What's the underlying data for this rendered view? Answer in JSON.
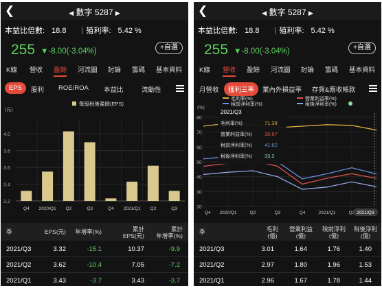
{
  "left": {
    "title": "數字 5287",
    "pe_label": "本益比倍數:",
    "pe_value": "18.8",
    "yield_label": "殖利率:",
    "yield_value": "5.42 %",
    "price": "255",
    "change": "▼-8.00(-3.04%)",
    "watch_label": "+自選",
    "tabs": [
      "K線",
      "營收",
      "盈餘",
      "河流圖",
      "討論",
      "籌碼",
      "基本資料"
    ],
    "active_tab": 2,
    "subtabs": [
      "EPS",
      "股利",
      "ROE/ROA",
      "本益比",
      "流動性"
    ],
    "active_subtab": 0,
    "chart_data": {
      "type": "bar",
      "legend": "每股稅後盈餘(EPS)",
      "unit_label": "(元)",
      "categories": [
        "Q4",
        "2020/Q1",
        "Q2",
        "Q3",
        "Q4",
        "2021/Q1",
        "Q2",
        "Q3"
      ],
      "values": [
        3.32,
        3.55,
        4.03,
        3.9,
        3.23,
        3.43,
        3.62,
        3.32
      ],
      "ylim": [
        3.2,
        4.1
      ],
      "yticks": [
        "4.0",
        "3.8",
        "3.6",
        "3.4",
        "3.2"
      ],
      "bar_color": "#d9c98f"
    },
    "table": {
      "headers": [
        "季",
        "EPS(元)",
        "年增率(%)",
        "累計EPS(元)",
        "累計年增率(%)"
      ],
      "headers_display": [
        [
          "季"
        ],
        [
          "EPS(元)"
        ],
        [
          "年增率(%)"
        ],
        [
          "累計",
          "EPS(元)"
        ],
        [
          "累計",
          "年增率(%)"
        ]
      ],
      "rows": [
        [
          "2021/Q3",
          "3.32",
          "-15.1",
          "10.37",
          "-9.9"
        ],
        [
          "2021/Q2",
          "3.62",
          "-10.4",
          "7.05",
          "-7.2"
        ],
        [
          "2021/Q1",
          "3.43",
          "-3.7",
          "3.43",
          "-3.7"
        ]
      ]
    }
  },
  "right": {
    "title": "數字 5287",
    "pe_label": "本益比倍數:",
    "pe_value": "18.8",
    "yield_label": "殖利率:",
    "yield_value": "5.42 %",
    "price": "255",
    "change": "▼-8.00(-3.04%)",
    "watch_label": "+自選",
    "tabs": [
      "K線",
      "營收",
      "盈餘",
      "河流圖",
      "討論",
      "籌碼",
      "基本資料"
    ],
    "active_tab": 1,
    "subtabs": [
      "月營收",
      "獲利三率",
      "業內外損益率",
      "存貨&應收帳款"
    ],
    "active_subtab": 1,
    "chart_data": {
      "type": "line",
      "unit_label": "(%)",
      "legend": [
        {
          "name": "毛利率(%)",
          "color": "#e0b040"
        },
        {
          "name": "營業利益率(%)",
          "color": "#e05050"
        },
        {
          "name": "稅前淨利率(%)",
          "color": "#6a8fe0"
        },
        {
          "name": "稅後淨利率(%)",
          "color": "#8fa8e0"
        }
      ],
      "categories": [
        "Q4",
        "2020/Q1",
        "Q2",
        "Q3",
        "Q4",
        "2021/Q1",
        "Q2",
        "Q3"
      ],
      "yticks": [
        "80",
        "70",
        "60",
        "50",
        "40",
        "30",
        "20"
      ],
      "ylim": [
        20,
        80
      ],
      "series": [
        {
          "name": "毛利率(%)",
          "color": "#e0b040",
          "values": [
            74,
            76,
            75,
            73,
            74,
            75,
            74.5,
            71.38
          ]
        },
        {
          "name": "營業利益率(%)",
          "color": "#e05050",
          "values": [
            47,
            49,
            51,
            47,
            35,
            39,
            42,
            38.87
          ]
        },
        {
          "name": "稅前淨利率(%)",
          "color": "#6a8fe0",
          "values": [
            52,
            53.5,
            54.5,
            50,
            38.5,
            42,
            46,
            41.82
          ]
        },
        {
          "name": "稅後淨利率(%)",
          "color": "#8fa8e0",
          "values": [
            41.5,
            43,
            44,
            40,
            31.5,
            33,
            36.5,
            33.2
          ]
        }
      ],
      "tooltip": {
        "title": "2021/Q3",
        "rows": [
          {
            "label": "毛利率(%)",
            "value": "71.38",
            "color": "#e0b040"
          },
          {
            "label": "營業利益率(%)",
            "value": "38.87",
            "color": "#e05050"
          },
          {
            "label": "稅前淨利率(%)",
            "value": "41.82",
            "color": "#6a8fe0"
          },
          {
            "label": "稅後淨利率(%)",
            "value": "33.2",
            "color": "#8fe0a0"
          }
        ]
      },
      "cursor_label": "2021/Q3"
    },
    "table": {
      "headers": [
        "季",
        "毛利(億)",
        "營業利益(億)",
        "稅前淨利(億)",
        "稅後淨利(億)"
      ],
      "headers_display": [
        [
          "季"
        ],
        [
          "毛利",
          "(億)"
        ],
        [
          "營業利益",
          "(億)"
        ],
        [
          "稅前淨利",
          "(億)"
        ],
        [
          "稅後淨利",
          "(億)"
        ]
      ],
      "rows": [
        [
          "2021/Q3",
          "3.01",
          "1.64",
          "1.76",
          "1.40"
        ],
        [
          "2021/Q2",
          "2.97",
          "1.80",
          "1.96",
          "1.53"
        ],
        [
          "2021/Q1",
          "2.96",
          "1.67",
          "1.78",
          "1.44"
        ]
      ]
    }
  },
  "colors": {
    "accent": "#e44a3a",
    "down": "#5fd35f",
    "background": "#131313"
  }
}
